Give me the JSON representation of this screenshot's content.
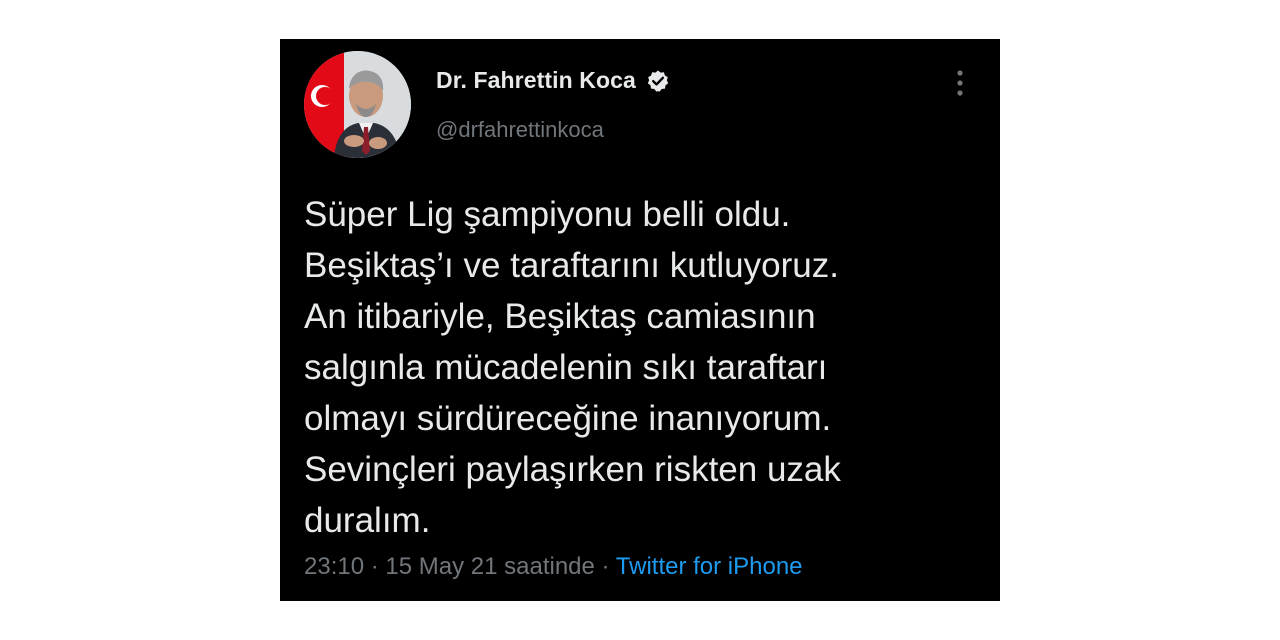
{
  "tweet": {
    "author": {
      "display_name": "Dr. Fahrettin Koca",
      "handle": "@drfahrettinkoca",
      "verified": true
    },
    "text_lines": [
      "Süper Lig şampiyonu belli oldu.",
      "Beşiktaş’ı ve taraftarını kutluyoruz.",
      "An itibariyle, Beşiktaş camiasının",
      "salgınla mücadelenin sıkı taraftarı",
      "olmayı sürdüreceğine inanıyorum.",
      "Sevinçleri paylaşırken riskten uzak",
      "duralım."
    ],
    "time": "23:10",
    "separator": " · ",
    "date": "15 May 21 saatinde",
    "source": "Twitter for iPhone"
  },
  "colors": {
    "background": "#000000",
    "text": "#e7e9ea",
    "muted": "#71767b",
    "link": "#1d9bf0",
    "flag_red": "#e30a17"
  },
  "icons": {
    "verified": "verified-badge-icon",
    "more": "more-vertical-icon"
  }
}
